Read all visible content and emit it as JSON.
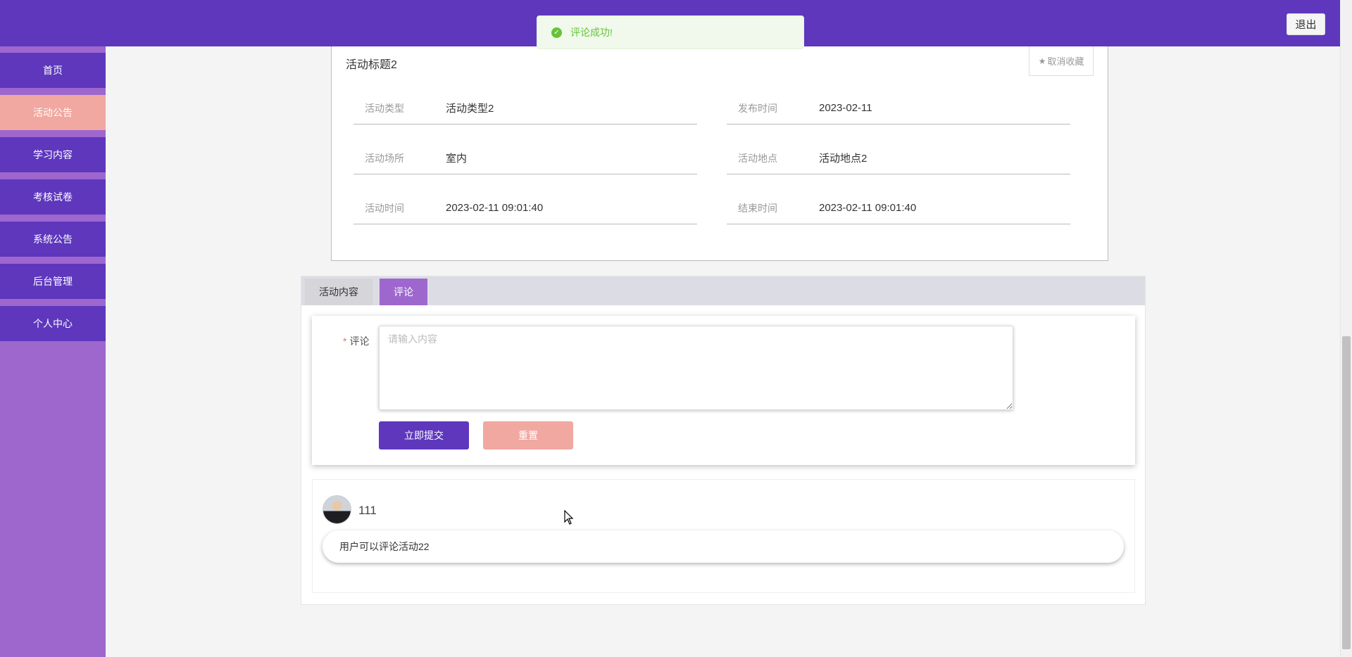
{
  "header": {
    "logout_label": "退出"
  },
  "sidebar": {
    "items": [
      {
        "label": "首页",
        "active": false
      },
      {
        "label": "活动公告",
        "active": true
      },
      {
        "label": "学习内容",
        "active": false
      },
      {
        "label": "考核试卷",
        "active": false
      },
      {
        "label": "系统公告",
        "active": false
      },
      {
        "label": "后台管理",
        "active": false
      },
      {
        "label": "个人中心",
        "active": false
      }
    ]
  },
  "toast": {
    "message": "评论成功!",
    "icon": "check-circle-icon",
    "color": "#67c23a"
  },
  "detail": {
    "title": "活动标题2",
    "favorite_label": "取消收藏",
    "fields": {
      "type": {
        "label": "活动类型",
        "value": "活动类型2"
      },
      "publish_time": {
        "label": "发布时间",
        "value": "2023-02-11"
      },
      "venue": {
        "label": "活动场所",
        "value": "室内"
      },
      "location": {
        "label": "活动地点",
        "value": "活动地点2"
      },
      "start_time": {
        "label": "活动时间",
        "value": "2023-02-11 09:01:40"
      },
      "end_time": {
        "label": "结束时间",
        "value": "2023-02-11 09:01:40"
      }
    }
  },
  "tabs": {
    "content_label": "活动内容",
    "comment_label": "评论",
    "active": "评论"
  },
  "comment_form": {
    "required_mark": "*",
    "label": "评论",
    "placeholder": "请输入内容",
    "value": "",
    "submit_label": "立即提交",
    "reset_label": "重置"
  },
  "comments": [
    {
      "user": "111",
      "text": "用户可以评论活动22"
    }
  ],
  "colors": {
    "primary": "#5e37bd",
    "sidebar_bg": "#9e67ce",
    "active_nav": "#f0a8a0",
    "success": "#67c23a"
  }
}
